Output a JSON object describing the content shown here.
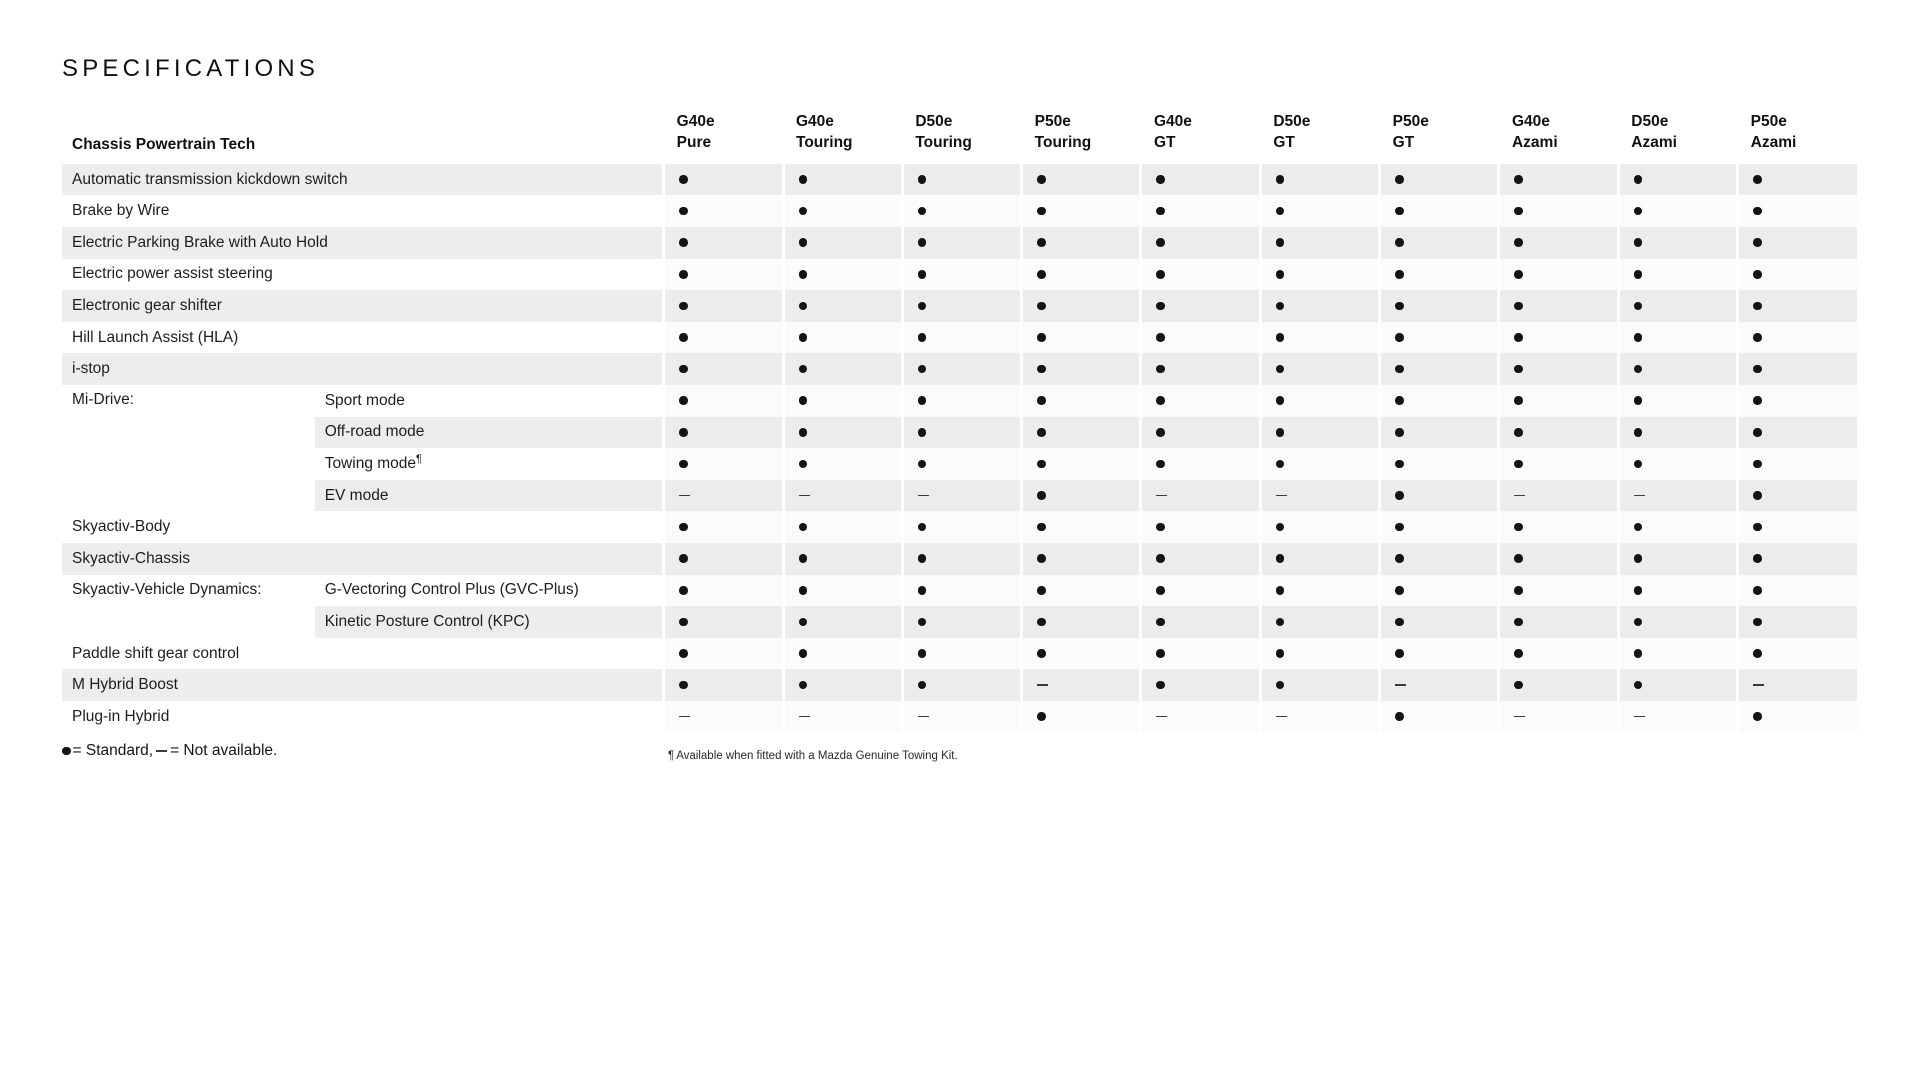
{
  "page": {
    "title": "SPECIFICATIONS"
  },
  "table": {
    "label_header": "Chassis Powertrain Tech",
    "columns": [
      {
        "line1": "G40e",
        "line2": "Pure"
      },
      {
        "line1": "G40e",
        "line2": "Touring"
      },
      {
        "line1": "D50e",
        "line2": "Touring"
      },
      {
        "line1": "P50e",
        "line2": "Touring"
      },
      {
        "line1": "G40e",
        "line2": "GT"
      },
      {
        "line1": "D50e",
        "line2": "GT"
      },
      {
        "line1": "P50e",
        "line2": "GT"
      },
      {
        "line1": "G40e",
        "line2": "Azami"
      },
      {
        "line1": "D50e",
        "line2": "Azami"
      },
      {
        "line1": "P50e",
        "line2": "Azami"
      }
    ],
    "columns_full": [
      {
        "line1": "G40e",
        "line2": "Pure"
      },
      {
        "line1": "G40e",
        "line2": "Touring"
      },
      {
        "line1": "D50e",
        "line2": "Touring"
      },
      {
        "line1": "P50e",
        "line2": "Touring"
      },
      {
        "line1": "G40e",
        "line2": "GT"
      },
      {
        "line1": "D50e",
        "line2": "GT"
      },
      {
        "line1": "P50e",
        "line2": "GT"
      },
      {
        "line1": "G40e",
        "line2": "Azami"
      },
      {
        "line1": "D50e",
        "line2": "Azami"
      },
      {
        "line1": "P50e",
        "line2": "Azami"
      }
    ],
    "rows": [
      {
        "label": "Automatic transmission kickdown switch",
        "sublabel": "",
        "group": "",
        "values": [
          "dot",
          "dot",
          "dot",
          "dot",
          "dot",
          "dot",
          "dot",
          "dot",
          "dot",
          "dot"
        ]
      },
      {
        "label": "Brake by Wire",
        "sublabel": "",
        "group": "",
        "values": [
          "dot",
          "dot",
          "dot",
          "dot",
          "dot",
          "dot",
          "dot",
          "dot",
          "dot",
          "dot"
        ]
      },
      {
        "label": "Electric Parking Brake with Auto Hold",
        "sublabel": "",
        "group": "",
        "values": [
          "dot",
          "dot",
          "dot",
          "dot",
          "dot",
          "dot",
          "dot",
          "dot",
          "dot",
          "dot"
        ]
      },
      {
        "label": "Electric power assist steering",
        "sublabel": "",
        "group": "",
        "values": [
          "dot",
          "dot",
          "dot",
          "dot",
          "dot",
          "dot",
          "dot",
          "dot",
          "dot",
          "dot"
        ]
      },
      {
        "label": "Electronic gear shifter",
        "sublabel": "",
        "group": "",
        "values": [
          "dot",
          "dot",
          "dot",
          "dot",
          "dot",
          "dot",
          "dot",
          "dot",
          "dot",
          "dot"
        ]
      },
      {
        "label": "Hill Launch Assist (HLA)",
        "sublabel": "",
        "group": "",
        "values": [
          "dot",
          "dot",
          "dot",
          "dot",
          "dot",
          "dot",
          "dot",
          "dot",
          "dot",
          "dot"
        ]
      },
      {
        "label": "i-stop",
        "sublabel": "",
        "group": "",
        "values": [
          "dot",
          "dot",
          "dot",
          "dot",
          "dot",
          "dot",
          "dot",
          "dot",
          "dot",
          "dot"
        ]
      },
      {
        "label": "Mi-Drive:",
        "sublabel": "Sport mode",
        "group": "start",
        "group_span": 4,
        "values": [
          "dot",
          "dot",
          "dot",
          "dot",
          "dot",
          "dot",
          "dot",
          "dot",
          "dot",
          "dot"
        ]
      },
      {
        "label": "",
        "sublabel": "Off-road mode",
        "group": "mid",
        "values": [
          "dot",
          "dot",
          "dot",
          "dot",
          "dot",
          "dot",
          "dot",
          "dot",
          "dot",
          "dot"
        ]
      },
      {
        "label": "",
        "sublabel": "Towing mode",
        "sublabel_sup": "¶",
        "group": "mid",
        "values": [
          "dot",
          "dot",
          "dot",
          "dot",
          "dot",
          "dot",
          "dot",
          "dot",
          "dot",
          "dot"
        ]
      },
      {
        "label": "",
        "sublabel": "EV mode",
        "group": "end",
        "values": [
          "dash",
          "dash",
          "dash",
          "dot",
          "dash",
          "dash",
          "dot",
          "dash",
          "dash",
          "dot"
        ]
      },
      {
        "label": "Skyactiv-Body",
        "sublabel": "",
        "group": "",
        "values": [
          "dot",
          "dot",
          "dot",
          "dot",
          "dot",
          "dot",
          "dot",
          "dot",
          "dot",
          "dot"
        ]
      },
      {
        "label": "Skyactiv-Chassis",
        "sublabel": "",
        "group": "",
        "values": [
          "dot",
          "dot",
          "dot",
          "dot",
          "dot",
          "dot",
          "dot",
          "dot",
          "dot",
          "dot"
        ]
      },
      {
        "label": "Skyactiv-Vehicle Dynamics:",
        "sublabel": "G-Vectoring Control Plus (GVC-Plus)",
        "group": "start",
        "group_span": 2,
        "values": [
          "dot",
          "dot",
          "dot",
          "dot",
          "dot",
          "dot",
          "dot",
          "dot",
          "dot",
          "dot"
        ]
      },
      {
        "label": "",
        "sublabel": "Kinetic Posture Control (KPC)",
        "group": "end",
        "values": [
          "dot",
          "dot",
          "dot",
          "dot",
          "dot",
          "dot",
          "dot",
          "dot",
          "dot",
          "dot"
        ]
      },
      {
        "label": "Paddle shift gear control",
        "sublabel": "",
        "group": "",
        "values": [
          "dot",
          "dot",
          "dot",
          "dot",
          "dot",
          "dot",
          "dot",
          "dot",
          "dot",
          "dot"
        ]
      },
      {
        "label": "M Hybrid Boost",
        "sublabel": "",
        "group": "",
        "values": [
          "dot",
          "dot",
          "dot",
          "dash",
          "dot",
          "dot",
          "dash",
          "dot",
          "dot",
          "dash"
        ]
      },
      {
        "label": "Plug-in Hybrid",
        "sublabel": "",
        "group": "",
        "values": [
          "dash",
          "dash",
          "dash",
          "dot",
          "dash",
          "dash",
          "dot",
          "dash",
          "dash",
          "dot"
        ]
      }
    ]
  },
  "legend": {
    "dot_equals": "= Standard,",
    "dash_equals": "= Not available."
  },
  "footnote": {
    "marker": "¶",
    "text": "Available when fitted with a Mazda Genuine Towing Kit."
  }
}
